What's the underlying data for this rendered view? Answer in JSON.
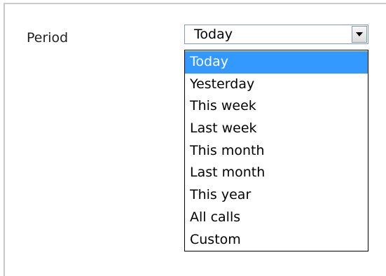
{
  "period": {
    "label": "Period",
    "selected_value": "Today",
    "options": [
      "Today",
      "Yesterday",
      "This week",
      "Last week",
      "This month",
      "Last month",
      "This year",
      "All calls",
      "Custom"
    ],
    "highlight_color": "#3399ff",
    "arrow_icon": "chevron-down-icon"
  }
}
